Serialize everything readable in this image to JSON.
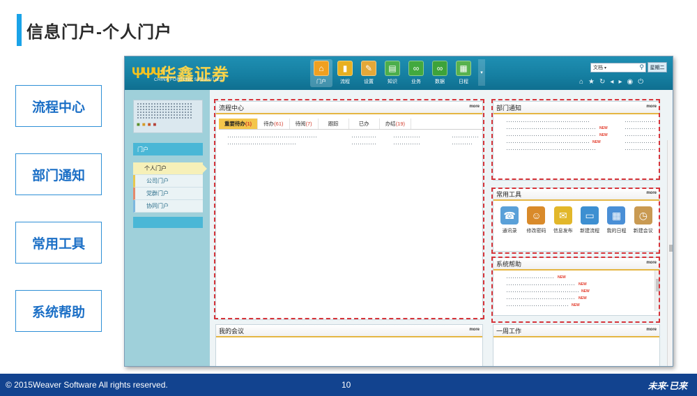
{
  "slide": {
    "title": "信息门户-个人门户",
    "labels": [
      "流程中心",
      "部门通知",
      "常用工具",
      "系统帮助"
    ],
    "footer_copy": "© 2015Weaver   Software  All rights reserved.",
    "page_number": "10",
    "footer_logo": "未来·已来"
  },
  "app": {
    "brand_cn": "华鑫证券",
    "brand_en": "CHINA FORTUNE SECURITIES",
    "nav": [
      {
        "label": "门户",
        "icon": "home-icon",
        "color": "#f0a020"
      },
      {
        "label": "流程",
        "icon": "bar-chart-icon",
        "color": "#e8b020"
      },
      {
        "label": "设置",
        "icon": "wrench-icon",
        "color": "#e4a838"
      },
      {
        "label": "知识",
        "icon": "document-icon",
        "color": "#4cae4c"
      },
      {
        "label": "业务",
        "icon": "infinity-icon",
        "color": "#42a93f"
      },
      {
        "label": "数据",
        "icon": "infinity-icon",
        "color": "#3da33a"
      },
      {
        "label": "日程",
        "icon": "calendar-icon",
        "color": "#58b24e"
      }
    ],
    "search_placeholder": "文档",
    "weekday": "星期二",
    "sidebar": {
      "head": "门户",
      "items": [
        "个人门户",
        "公司门户",
        "党群门户",
        "协同门户"
      ]
    },
    "process": {
      "title": "流程中心",
      "more": "more",
      "tabs": [
        {
          "label": "重要待办",
          "count": "(1)"
        },
        {
          "label": "待办",
          "count": "(61)"
        },
        {
          "label": "待阅",
          "count": "(7)"
        },
        {
          "label": "跟踪",
          "count": ""
        },
        {
          "label": "已办",
          "count": ""
        },
        {
          "label": "办结",
          "count": "(19)"
        }
      ]
    },
    "notice": {
      "title": "部门通知",
      "more": "more"
    },
    "tools": {
      "title": "常用工具",
      "more": "more",
      "items": [
        {
          "label": "通讯录",
          "icon": "contacts-icon",
          "color": "#5aa0d8"
        },
        {
          "label": "修改密码",
          "icon": "users-key-icon",
          "color": "#d98a2a"
        },
        {
          "label": "信息发布",
          "icon": "announce-icon",
          "color": "#e2b72a"
        },
        {
          "label": "新建流程",
          "icon": "monitor-icon",
          "color": "#3d8fd1"
        },
        {
          "label": "我的日程",
          "icon": "calendar-icon",
          "color": "#4a8fd6"
        },
        {
          "label": "新建会议",
          "icon": "clock-icon",
          "color": "#c99a52"
        }
      ]
    },
    "help": {
      "title": "系统帮助",
      "more": "more"
    },
    "meeting": {
      "title": "我的会议",
      "more": "more"
    },
    "week": {
      "title": "一周工作",
      "more": "more"
    }
  }
}
